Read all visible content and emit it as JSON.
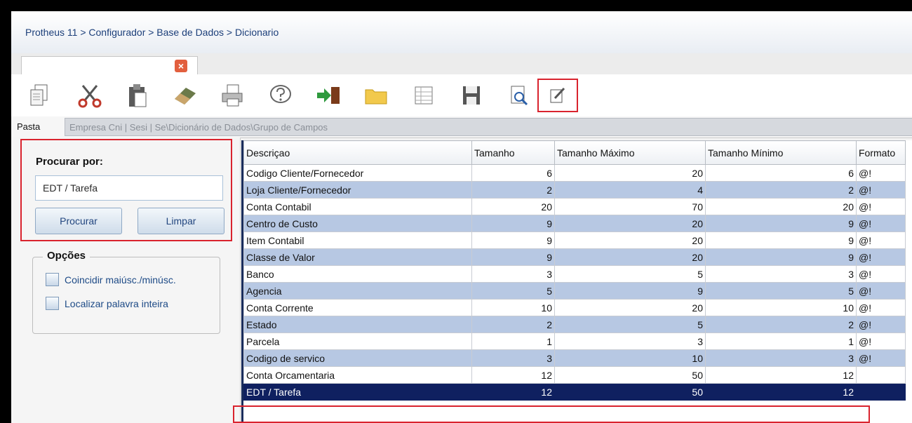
{
  "breadcrumb": "Protheus 11 > Configurador > Base de Dados > Dicionario",
  "tab": {
    "close_symbol": "×"
  },
  "toolbar": {
    "icons": [
      "copy-icon",
      "cut-icon",
      "paste-icon",
      "eraser-icon",
      "print-icon",
      "help-icon",
      "exit-icon",
      "folder-icon",
      "grid-icon",
      "save-icon",
      "preview-icon",
      "edit-icon"
    ]
  },
  "folder": {
    "label": "Pasta",
    "path": "Empresa Cni | Sesi | Se\\Dicionário de Dados\\Grupo de Campos"
  },
  "search": {
    "title": "Procurar por:",
    "value": "EDT / Tarefa",
    "search_btn": "Procurar",
    "clear_btn": "Limpar"
  },
  "options": {
    "title": "Opções",
    "match_case": "Coincidir maiúsc./minúsc.",
    "whole_word": "Localizar palavra inteira"
  },
  "table": {
    "headers": [
      "Descriçao",
      "Tamanho",
      "Tamanho Máximo",
      "Tamanho Mínimo",
      "Formato"
    ],
    "rows": [
      [
        "Codigo Cliente/Fornecedor",
        "6",
        "20",
        "6",
        "@!"
      ],
      [
        "Loja Cliente/Fornecedor",
        "2",
        "4",
        "2",
        "@!"
      ],
      [
        "Conta Contabil",
        "20",
        "70",
        "20",
        "@!"
      ],
      [
        "Centro de Custo",
        "9",
        "20",
        "9",
        "@!"
      ],
      [
        "Item Contabil",
        "9",
        "20",
        "9",
        "@!"
      ],
      [
        "Classe de Valor",
        "9",
        "20",
        "9",
        "@!"
      ],
      [
        "Banco",
        "3",
        "5",
        "3",
        "@!"
      ],
      [
        "Agencia",
        "5",
        "9",
        "5",
        "@!"
      ],
      [
        "Conta Corrente",
        "10",
        "20",
        "10",
        "@!"
      ],
      [
        "Estado",
        "2",
        "5",
        "2",
        "@!"
      ],
      [
        "Parcela",
        "1",
        "3",
        "1",
        "@!"
      ],
      [
        "Codigo de servico",
        "3",
        "10",
        "3",
        "@!"
      ],
      [
        "Conta Orcamentaria",
        "12",
        "50",
        "12",
        ""
      ],
      [
        "EDT / Tarefa",
        "12",
        "50",
        "12",
        ""
      ]
    ],
    "selected_row": 13
  },
  "colors": {
    "accent_red": "#d9232e",
    "row_alt": "#b7c8e3",
    "selected": "#0f2060"
  }
}
